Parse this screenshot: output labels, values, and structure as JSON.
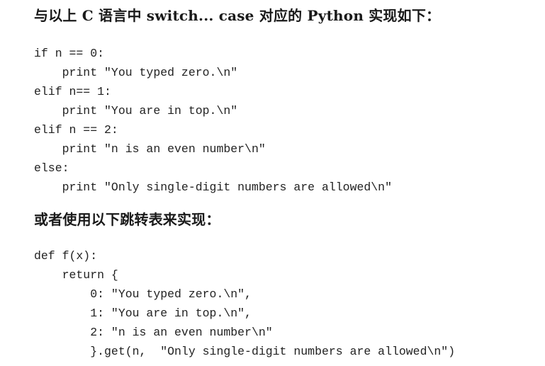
{
  "heading1": "与以上 C 语言中 switch... case 对应的 Python 实现如下：",
  "code1": [
    "if n == 0:",
    "    print \"You typed zero.\\n\"",
    "elif n== 1:",
    "    print \"You are in top.\\n\"",
    "elif n == 2:",
    "    print \"n is an even number\\n\"",
    "else:",
    "    print \"Only single-digit numbers are allowed\\n\""
  ],
  "heading2": "或者使用以下跳转表来实现：",
  "code2": [
    "def f(x):",
    "    return {",
    "        0: \"You typed zero.\\n\",",
    "        1: \"You are in top.\\n\",",
    "        2: \"n is an even number\\n\"",
    "        }.get(n,  \"Only single-digit numbers are allowed\\n\")"
  ]
}
